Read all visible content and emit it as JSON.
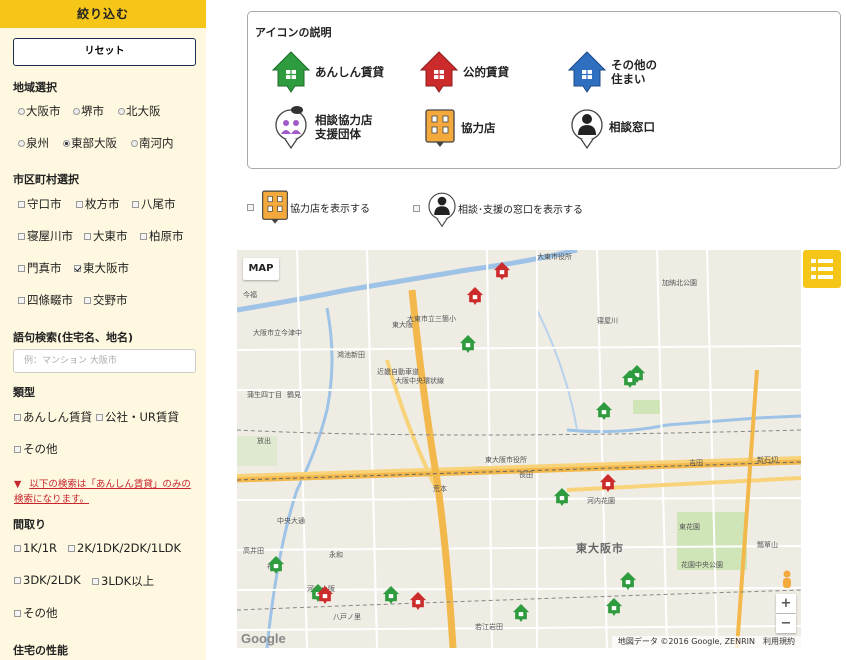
{
  "sidebar": {
    "header": "絞り込む",
    "reset": "リセット",
    "region": {
      "title": "地域選択",
      "options": [
        "大阪市",
        "堺市",
        "北大阪",
        "泉州",
        "東部大阪",
        "南河内"
      ],
      "selected": "東部大阪"
    },
    "city": {
      "title": "市区町村選択",
      "options": [
        "守口市",
        "枚方市",
        "八尾市",
        "寝屋川市",
        "大東市",
        "柏原市",
        "門真市",
        "東大阪市",
        "四條畷市",
        "交野市"
      ],
      "checked": [
        "東大阪市"
      ]
    },
    "keyword": {
      "title": "語句検索(住宅名、地名)",
      "placeholder": "例：マンション 大阪市"
    },
    "kind": {
      "title": "類型",
      "options": [
        "あんしん賃貸",
        "公社・UR賃貸",
        "その他"
      ],
      "warning_marker": "▼",
      "warning_line1": "以下の検索は「あんしん賃貸」のみの",
      "warning_line2": "検索になります。"
    },
    "layout": {
      "title": "間取り",
      "options": [
        "1K/1R",
        "2K/1DK/2DK/1LDK",
        "3DK/2LDK",
        "3LDK以上",
        "その他"
      ]
    },
    "perf_title": "住宅の性能"
  },
  "legend": {
    "title": "アイコンの説明",
    "items": [
      {
        "line1": "あんしん賃貸",
        "line2": "",
        "icon": "green-house-icon"
      },
      {
        "line1": "公的賃貸",
        "line2": "",
        "icon": "red-house-icon"
      },
      {
        "line1": "その他の",
        "line2": "住まい",
        "icon": "blue-house-icon"
      },
      {
        "line1": "相談協力店",
        "line2": "支援団体",
        "icon": "support-group-icon"
      },
      {
        "line1": "協力店",
        "line2": "",
        "icon": "store-icon"
      },
      {
        "line1": "相談窓口",
        "line2": "",
        "icon": "person-icon"
      }
    ]
  },
  "toggles": {
    "stores": "協力店を表示する",
    "counters": "相談･支援の窓口を表示する"
  },
  "map": {
    "type_button": "MAP",
    "ward_label": "東大阪市",
    "attribution": "地図データ ©2016 Google, ZENRIN　利用規約",
    "brand": "Google",
    "zoom_in": "+",
    "zoom_out": "−",
    "labels": [
      "大東市役所",
      "大東市立三箇小",
      "加納北公園",
      "寝屋川",
      "東大阪",
      "大阪市立今津中",
      "鴻池新田",
      "東大阪市役所",
      "近畿自動車道",
      "大阪中央環状線",
      "長田",
      "荒本",
      "新石切",
      "吉田",
      "河内花園",
      "花園中央公園",
      "東花園",
      "瓢箪山",
      "八戸ノ里",
      "布施",
      "永和",
      "若江岩田",
      "河内小阪",
      "高井田",
      "中央大通",
      "今福",
      "蒲生四丁目",
      "鶴見",
      "放出"
    ],
    "colors": {
      "green": "#2e9b3e",
      "red": "#cc2b2b",
      "blue": "#2f6fc0",
      "road": "#f2b84b"
    }
  }
}
